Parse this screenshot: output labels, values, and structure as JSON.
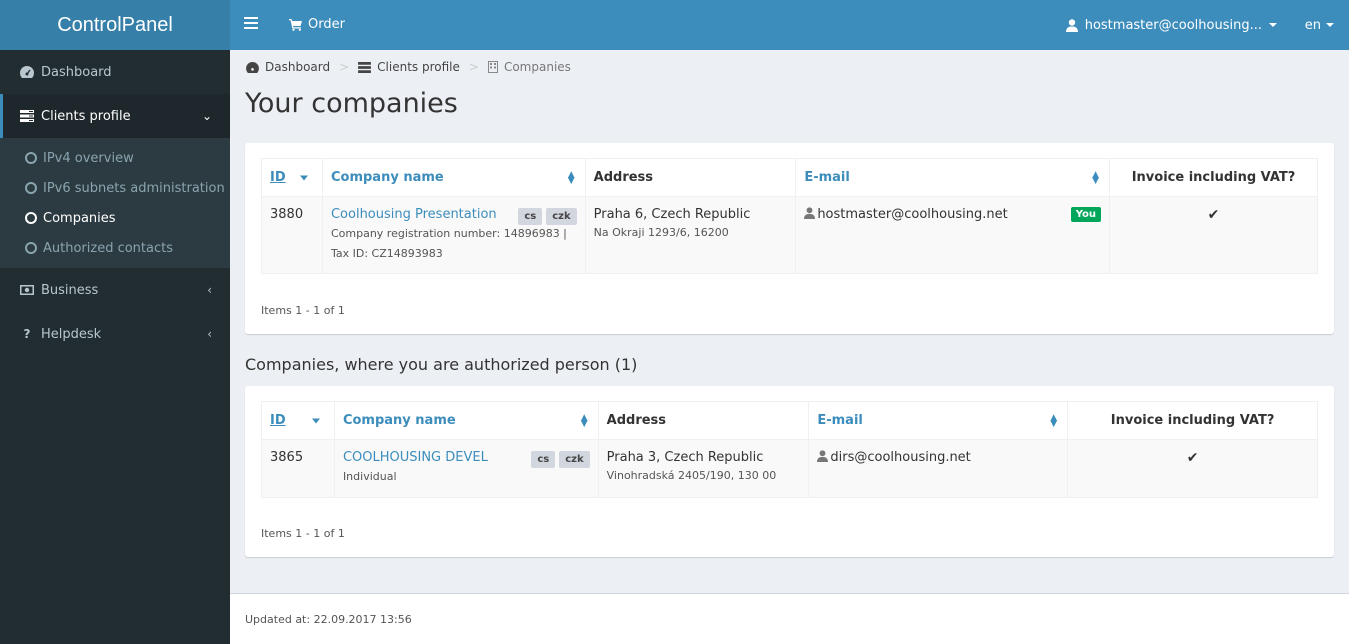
{
  "app": {
    "title": "ControlPanel"
  },
  "topbar": {
    "order_label": "Order",
    "user_label": "hostmaster@coolhousing...",
    "lang_label": "en"
  },
  "sidebar": {
    "items": [
      {
        "label": "Dashboard",
        "icon": "dashboard-icon"
      },
      {
        "label": "Clients profile",
        "icon": "server-icon",
        "expanded": true,
        "children": [
          {
            "label": "IPv4 overview"
          },
          {
            "label": "IPv6 subnets administration"
          },
          {
            "label": "Companies",
            "active": true
          },
          {
            "label": "Authorized contacts"
          }
        ]
      },
      {
        "label": "Business",
        "icon": "money-icon"
      },
      {
        "label": "Helpdesk",
        "icon": "question-icon"
      }
    ]
  },
  "breadcrumb": [
    {
      "label": "Dashboard",
      "icon": "dashboard-icon"
    },
    {
      "label": "Clients profile",
      "icon": "server-icon"
    },
    {
      "label": "Companies",
      "icon": "building-icon"
    }
  ],
  "page_title": "Your companies",
  "table_headers": {
    "id": "ID",
    "company": "Company name",
    "address": "Address",
    "email": "E-mail",
    "vat": "Invoice including VAT?"
  },
  "own_companies": {
    "rows": [
      {
        "id": "3880",
        "name": "Coolhousing Presentation",
        "tags": [
          "cs",
          "czk"
        ],
        "details": "Company registration number: 14896983 | Tax ID: CZ14893983",
        "address_main": "Praha 6, Czech Republic",
        "address_sub": "Na Okraji 1293/6, 16200",
        "email": "hostmaster@coolhousing.net",
        "email_badge": "You",
        "vat": "✔"
      }
    ],
    "items_info": "Items 1 - 1 of 1"
  },
  "authorized_section_title": "Companies, where you are authorized person (1)",
  "authorized_companies": {
    "rows": [
      {
        "id": "3865",
        "name": "COOLHOUSING DEVEL",
        "tags": [
          "cs",
          "czk"
        ],
        "details": "Individual",
        "address_main": "Praha 3, Czech Republic",
        "address_sub": "Vinohradská 2405/190, 130 00",
        "email": "dirs@coolhousing.net",
        "vat": "✔"
      }
    ],
    "items_info": "Items 1 - 1 of 1"
  },
  "footer": {
    "updated": "Updated at: 22.09.2017 13:56"
  },
  "colors": {
    "brand": "#3c8dbc",
    "logo_bg": "#367fa9",
    "sidebar_bg": "#222d32",
    "success": "#00a65a"
  }
}
